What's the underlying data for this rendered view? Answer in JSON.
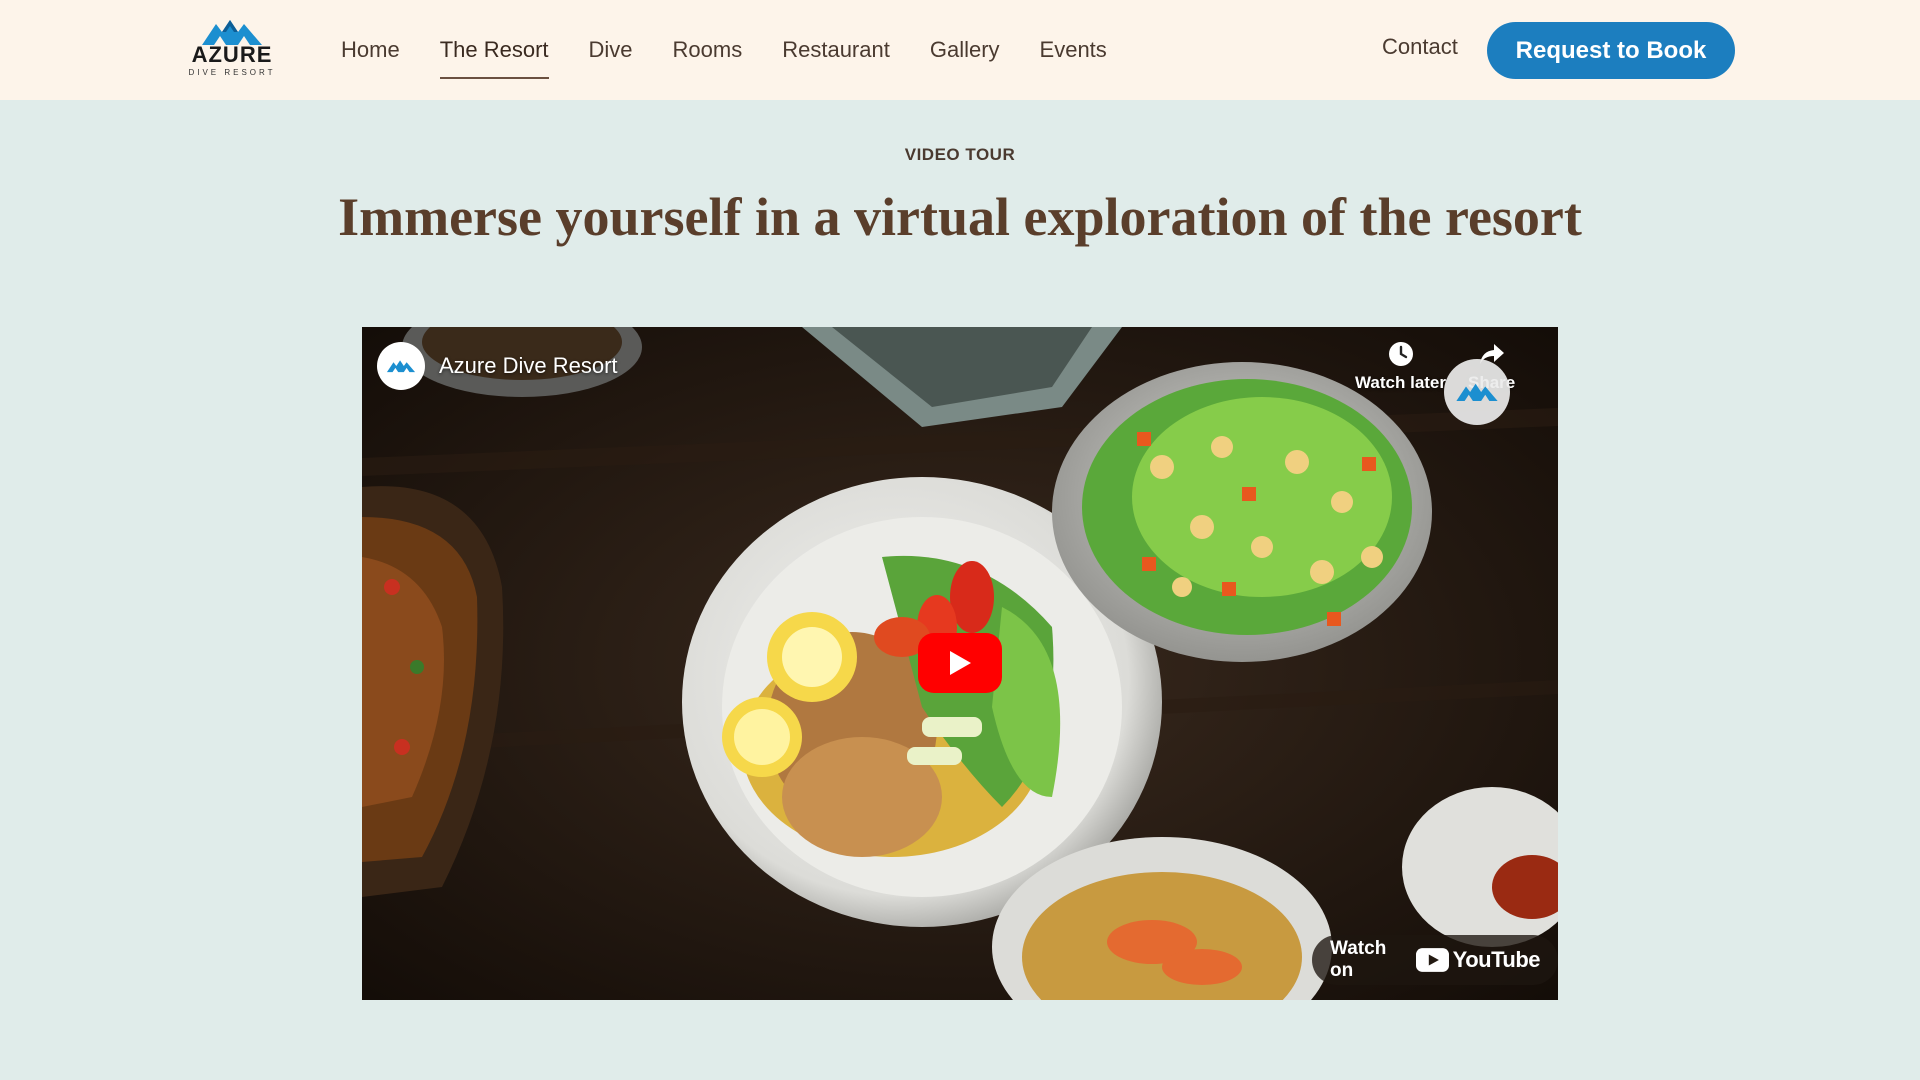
{
  "brand": {
    "name": "AZURE",
    "tagline": "DIVE RESORT",
    "accent": "#1c7ebf"
  },
  "nav": {
    "items": [
      {
        "label": "Home",
        "active": false
      },
      {
        "label": "The Resort",
        "active": true
      },
      {
        "label": "Dive",
        "active": false
      },
      {
        "label": "Rooms",
        "active": false
      },
      {
        "label": "Restaurant",
        "active": false
      },
      {
        "label": "Gallery",
        "active": false
      },
      {
        "label": "Events",
        "active": false
      }
    ],
    "contact": "Contact",
    "cta": "Request to Book"
  },
  "section": {
    "eyebrow": "VIDEO TOUR",
    "title": "Immerse yourself in a virtual exploration of the resort"
  },
  "video": {
    "channel_name": "Azure Dive Resort",
    "watch_later": "Watch later",
    "share": "Share",
    "watch_on": "Watch on",
    "platform": "YouTube",
    "play_color": "#ff0000"
  },
  "colors": {
    "header_bg": "#fdf4ea",
    "page_bg": "#e0ecea",
    "heading": "#5a3e2b"
  }
}
